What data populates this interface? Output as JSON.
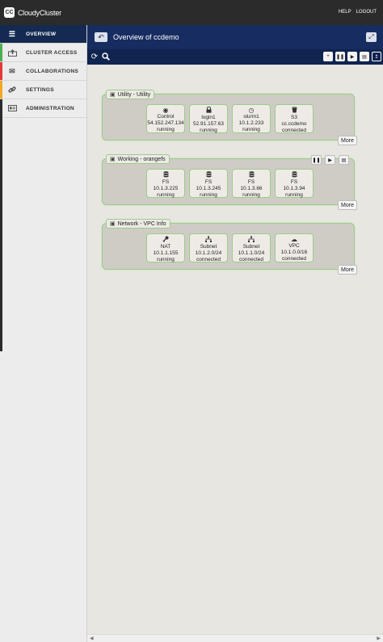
{
  "app": {
    "brand": "CloudyCluster",
    "logo_text": "CC"
  },
  "top_links": [
    "HELP",
    "LOGOUT"
  ],
  "sidebar": {
    "items": [
      {
        "label": "OVERVIEW",
        "icon": "menu-icon",
        "active": true
      },
      {
        "label": "CLUSTER ACCESS",
        "icon": "upload-icon",
        "stripe": "#4caf50"
      },
      {
        "label": "COLLABORATIONS",
        "icon": "mail-icon",
        "stripe": "#e53935"
      },
      {
        "label": "SETTINGS",
        "icon": "link-icon",
        "stripe": "#f5a623"
      },
      {
        "label": "ADMINISTRATION",
        "icon": "id-card-icon",
        "stripe": "#2b2b2b"
      }
    ]
  },
  "header": {
    "title": "Overview of ccdemo",
    "back_icon": "return-arrow-icon",
    "expand_icon": "expand-icon"
  },
  "toolbar": {
    "left_icons": [
      "refresh-icon",
      "search-icon"
    ],
    "right_buttons": [
      "add-icon",
      "pause-icon",
      "play-icon",
      "trash-icon",
      "upload-icon"
    ]
  },
  "groups": [
    {
      "label": "Utility - Utility",
      "more": "More",
      "show_actions": false,
      "tiles": [
        {
          "icon": "globe-icon",
          "name": "Control",
          "address": "54.152.247.134",
          "status": "running"
        },
        {
          "icon": "lock-icon",
          "name": "login1",
          "address": "52.91.157.63",
          "status": "running"
        },
        {
          "icon": "clock-icon",
          "name": "slurm1",
          "address": "10.1.2.233",
          "status": "running"
        },
        {
          "icon": "bucket-icon",
          "name": "S3",
          "address": "cc.ccdemo",
          "status": "connected"
        }
      ]
    },
    {
      "label": "Working - orangefs",
      "more": "More",
      "show_actions": true,
      "tiles": [
        {
          "icon": "database-icon",
          "name": "FS",
          "address": "10.1.3.225",
          "status": "running"
        },
        {
          "icon": "database-icon",
          "name": "FS",
          "address": "10.1.3.245",
          "status": "running"
        },
        {
          "icon": "database-icon",
          "name": "FS",
          "address": "10.1.3.66",
          "status": "running"
        },
        {
          "icon": "database-icon",
          "name": "FS",
          "address": "10.1.3.94",
          "status": "running"
        }
      ]
    },
    {
      "label": "Network - VPC Info",
      "more": "More",
      "show_actions": false,
      "tiles": [
        {
          "icon": "key-icon",
          "name": "NAT",
          "address": "10.1.1.155",
          "status": "running"
        },
        {
          "icon": "network-icon",
          "name": "Subnet",
          "address": "10.1.2.0/24",
          "status": "connected"
        },
        {
          "icon": "network-icon",
          "name": "Subnet",
          "address": "10.1.1.0/24",
          "status": "connected"
        },
        {
          "icon": "cloud-icon",
          "name": "VPC",
          "address": "10.1.0.0/16",
          "status": "connected"
        }
      ]
    }
  ],
  "colors": {
    "header_bg": "#172d61",
    "toolbar_bg": "#102450",
    "topbar_bg": "#2b2b2b",
    "group_border": "#9ccc8a"
  }
}
